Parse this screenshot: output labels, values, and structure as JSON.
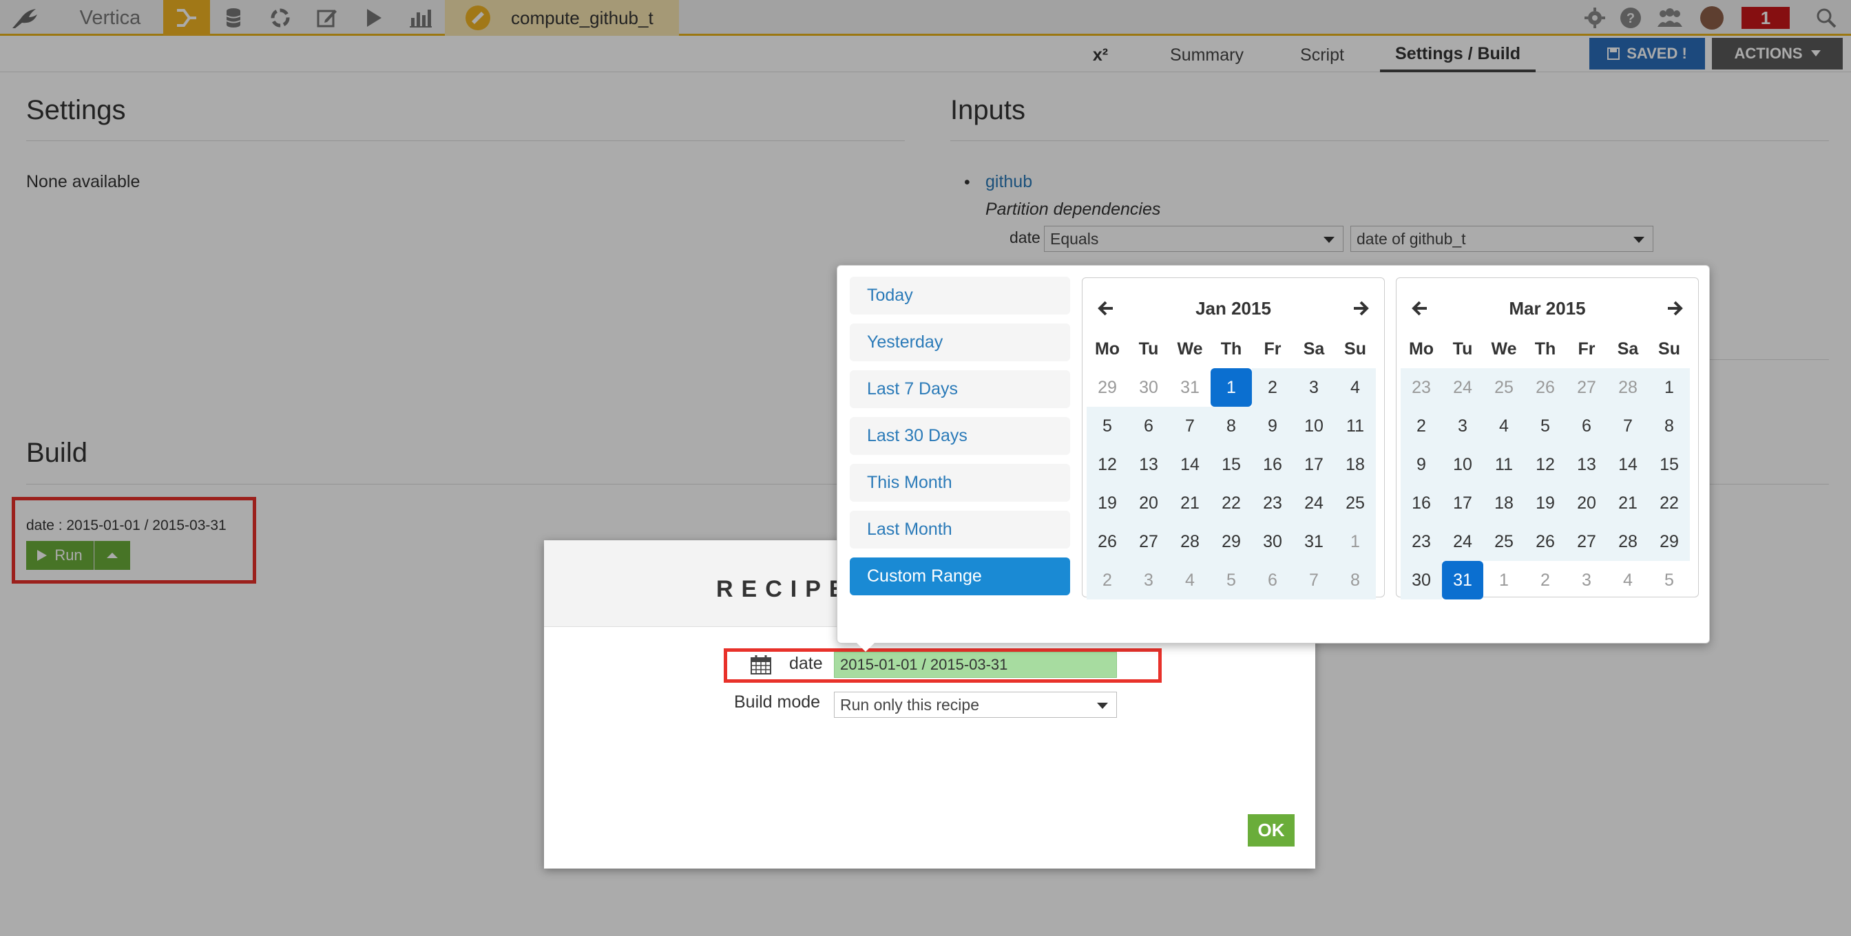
{
  "topbar": {
    "project_name": "Vertica",
    "recipe_name": "compute_github_t",
    "notification_count": "1",
    "accent_color": "#f0b323"
  },
  "subnav": {
    "formula_label": "x²",
    "tabs": [
      "Summary",
      "Script",
      "Settings / Build"
    ],
    "saved_label": "SAVED !",
    "actions_label": "ACTIONS"
  },
  "settings": {
    "title": "Settings",
    "none_text": "None available"
  },
  "inputs": {
    "title": "Inputs",
    "dataset_link": "github",
    "partition_label": "Partition dependencies",
    "dim_label": "date",
    "function_select": "Equals",
    "target_select": "date of github_t"
  },
  "build": {
    "title": "Build",
    "partition_text": "date : 2015-01-01 / 2015-03-31",
    "run_label": "Run",
    "run_color": "#6aad3a"
  },
  "modal": {
    "title": "RECIPE I",
    "date_label": "date",
    "date_value": "2015-01-01 / 2015-03-31",
    "build_mode_label": "Build mode",
    "build_mode_value": "Run only this recipe",
    "ok_label": "OK"
  },
  "picker": {
    "ranges": [
      "Today",
      "Yesterday",
      "Last 7 Days",
      "Last 30 Days",
      "This Month",
      "Last Month",
      "Custom Range"
    ],
    "active_range": "Custom Range",
    "weekdays": [
      "Mo",
      "Tu",
      "We",
      "Th",
      "Fr",
      "Sa",
      "Su"
    ],
    "calendars": [
      {
        "title": "Jan 2015",
        "days": [
          {
            "d": "29",
            "off": true,
            "in": false
          },
          {
            "d": "30",
            "off": true,
            "in": false
          },
          {
            "d": "31",
            "off": true,
            "in": false
          },
          {
            "d": "1",
            "off": false,
            "in": true,
            "sel": true
          },
          {
            "d": "2",
            "off": false,
            "in": true
          },
          {
            "d": "3",
            "off": false,
            "in": true
          },
          {
            "d": "4",
            "off": false,
            "in": true
          },
          {
            "d": "5",
            "off": false,
            "in": true
          },
          {
            "d": "6",
            "off": false,
            "in": true
          },
          {
            "d": "7",
            "off": false,
            "in": true
          },
          {
            "d": "8",
            "off": false,
            "in": true
          },
          {
            "d": "9",
            "off": false,
            "in": true
          },
          {
            "d": "10",
            "off": false,
            "in": true
          },
          {
            "d": "11",
            "off": false,
            "in": true
          },
          {
            "d": "12",
            "off": false,
            "in": true
          },
          {
            "d": "13",
            "off": false,
            "in": true
          },
          {
            "d": "14",
            "off": false,
            "in": true
          },
          {
            "d": "15",
            "off": false,
            "in": true
          },
          {
            "d": "16",
            "off": false,
            "in": true
          },
          {
            "d": "17",
            "off": false,
            "in": true
          },
          {
            "d": "18",
            "off": false,
            "in": true
          },
          {
            "d": "19",
            "off": false,
            "in": true
          },
          {
            "d": "20",
            "off": false,
            "in": true
          },
          {
            "d": "21",
            "off": false,
            "in": true
          },
          {
            "d": "22",
            "off": false,
            "in": true
          },
          {
            "d": "23",
            "off": false,
            "in": true
          },
          {
            "d": "24",
            "off": false,
            "in": true
          },
          {
            "d": "25",
            "off": false,
            "in": true
          },
          {
            "d": "26",
            "off": false,
            "in": true
          },
          {
            "d": "27",
            "off": false,
            "in": true
          },
          {
            "d": "28",
            "off": false,
            "in": true
          },
          {
            "d": "29",
            "off": false,
            "in": true
          },
          {
            "d": "30",
            "off": false,
            "in": true
          },
          {
            "d": "31",
            "off": false,
            "in": true
          },
          {
            "d": "1",
            "off": true,
            "in": true
          },
          {
            "d": "2",
            "off": true,
            "in": true
          },
          {
            "d": "3",
            "off": true,
            "in": true
          },
          {
            "d": "4",
            "off": true,
            "in": true
          },
          {
            "d": "5",
            "off": true,
            "in": true
          },
          {
            "d": "6",
            "off": true,
            "in": true
          },
          {
            "d": "7",
            "off": true,
            "in": true
          },
          {
            "d": "8",
            "off": true,
            "in": true
          }
        ]
      },
      {
        "title": "Mar 2015",
        "days": [
          {
            "d": "23",
            "off": true,
            "in": true
          },
          {
            "d": "24",
            "off": true,
            "in": true
          },
          {
            "d": "25",
            "off": true,
            "in": true
          },
          {
            "d": "26",
            "off": true,
            "in": true
          },
          {
            "d": "27",
            "off": true,
            "in": true
          },
          {
            "d": "28",
            "off": true,
            "in": true
          },
          {
            "d": "1",
            "off": false,
            "in": true
          },
          {
            "d": "2",
            "off": false,
            "in": true
          },
          {
            "d": "3",
            "off": false,
            "in": true
          },
          {
            "d": "4",
            "off": false,
            "in": true
          },
          {
            "d": "5",
            "off": false,
            "in": true
          },
          {
            "d": "6",
            "off": false,
            "in": true
          },
          {
            "d": "7",
            "off": false,
            "in": true
          },
          {
            "d": "8",
            "off": false,
            "in": true
          },
          {
            "d": "9",
            "off": false,
            "in": true
          },
          {
            "d": "10",
            "off": false,
            "in": true
          },
          {
            "d": "11",
            "off": false,
            "in": true
          },
          {
            "d": "12",
            "off": false,
            "in": true
          },
          {
            "d": "13",
            "off": false,
            "in": true
          },
          {
            "d": "14",
            "off": false,
            "in": true
          },
          {
            "d": "15",
            "off": false,
            "in": true
          },
          {
            "d": "16",
            "off": false,
            "in": true
          },
          {
            "d": "17",
            "off": false,
            "in": true
          },
          {
            "d": "18",
            "off": false,
            "in": true
          },
          {
            "d": "19",
            "off": false,
            "in": true
          },
          {
            "d": "20",
            "off": false,
            "in": true
          },
          {
            "d": "21",
            "off": false,
            "in": true
          },
          {
            "d": "22",
            "off": false,
            "in": true
          },
          {
            "d": "23",
            "off": false,
            "in": true
          },
          {
            "d": "24",
            "off": false,
            "in": true
          },
          {
            "d": "25",
            "off": false,
            "in": true
          },
          {
            "d": "26",
            "off": false,
            "in": true
          },
          {
            "d": "27",
            "off": false,
            "in": true
          },
          {
            "d": "28",
            "off": false,
            "in": true
          },
          {
            "d": "29",
            "off": false,
            "in": true
          },
          {
            "d": "30",
            "off": false,
            "in": true
          },
          {
            "d": "31",
            "off": false,
            "in": true,
            "sel": true
          },
          {
            "d": "1",
            "off": true,
            "in": false
          },
          {
            "d": "2",
            "off": true,
            "in": false
          },
          {
            "d": "3",
            "off": true,
            "in": false
          },
          {
            "d": "4",
            "off": true,
            "in": false
          },
          {
            "d": "5",
            "off": true,
            "in": false
          }
        ]
      }
    ]
  },
  "icons": {
    "logo": "bird-logo-icon",
    "flow": "flow-icon",
    "datasets": "database-icon",
    "recipes": "cycle-icon",
    "notebooks": "edit-icon",
    "jobs": "play-icon",
    "dashboards": "bar-chart-icon",
    "admin": "gear-icon",
    "help": "help-icon",
    "users": "users-icon",
    "search": "search-icon",
    "calendar": "calendar-icon"
  }
}
